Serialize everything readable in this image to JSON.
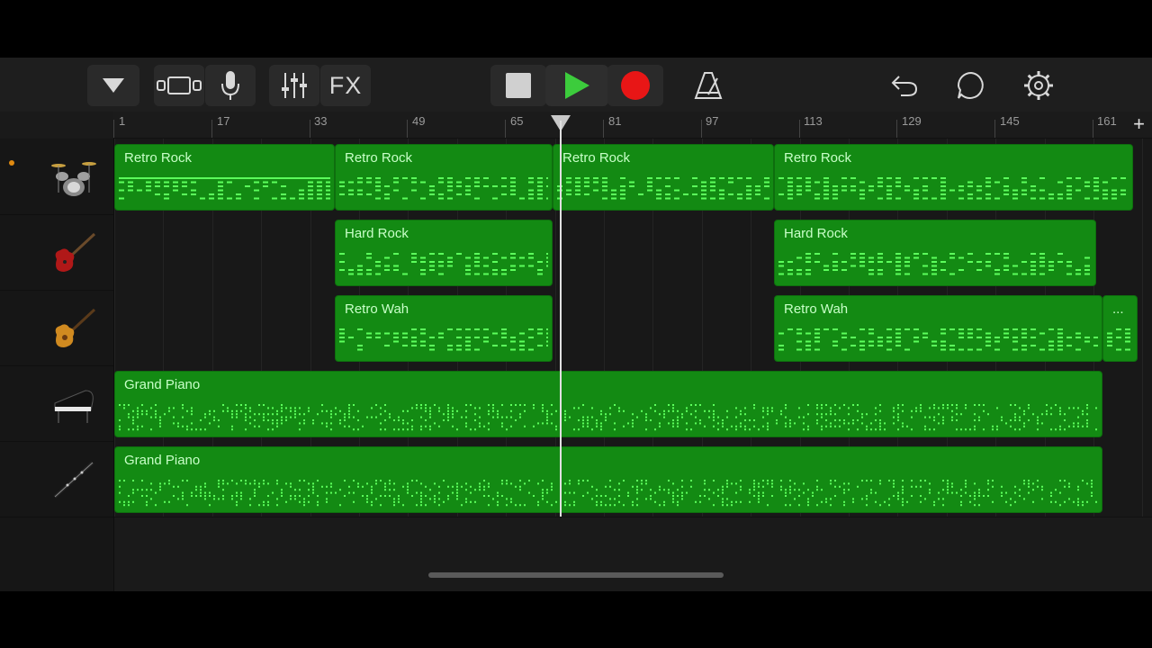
{
  "toolbar": {
    "fx_label": "FX",
    "colors": {
      "play": "#3ccc3c",
      "record": "#e81616"
    }
  },
  "ruler": {
    "marks": [
      "1",
      "17",
      "33",
      "49",
      "65",
      "81",
      "97",
      "113",
      "129",
      "145",
      "161"
    ],
    "add_label": "+"
  },
  "tracks": [
    {
      "instrument": "drum-kit-icon",
      "regions": [
        {
          "label": "Retro Rock",
          "start": 0,
          "end": 245
        },
        {
          "label": "Retro Rock",
          "start": 245,
          "end": 487
        },
        {
          "label": "Retro Rock",
          "start": 487,
          "end": 733
        },
        {
          "label": "Retro Rock",
          "start": 733,
          "end": 1132
        }
      ]
    },
    {
      "instrument": "red-electric-guitar-icon",
      "regions": [
        {
          "label": "Hard Rock",
          "start": 245,
          "end": 487
        },
        {
          "label": "Hard Rock",
          "start": 733,
          "end": 1091
        }
      ]
    },
    {
      "instrument": "sunburst-guitar-icon",
      "regions": [
        {
          "label": "Retro Wah",
          "start": 245,
          "end": 487
        },
        {
          "label": "Retro Wah",
          "start": 733,
          "end": 1098
        },
        {
          "label": "...",
          "start": 1098,
          "end": 1137
        }
      ]
    },
    {
      "instrument": "grand-piano-icon",
      "regions": [
        {
          "label": "Grand Piano",
          "start": 0,
          "end": 1098
        }
      ]
    },
    {
      "instrument": "clarinet-icon",
      "regions": [
        {
          "label": "Grand Piano",
          "start": 0,
          "end": 1098
        }
      ]
    }
  ],
  "add_track_label": "+",
  "colors": {
    "region": "#138a13",
    "notes": "#5cff5c",
    "background": "#1a1a1a"
  }
}
